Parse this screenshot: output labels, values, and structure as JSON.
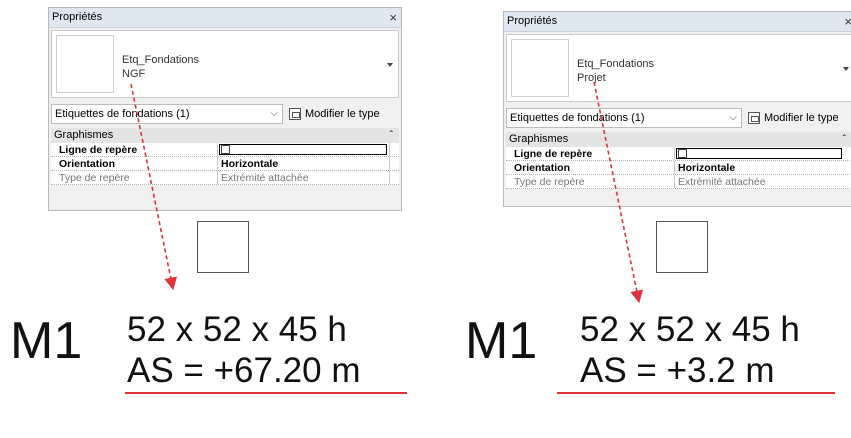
{
  "colors": {
    "arrow_red": "#e0323a",
    "title_bar": "#dfe7f1",
    "panel_bg": "#f0f0f0"
  },
  "left": {
    "title": "Propriétés",
    "close": "×",
    "type_name": "Etq_Fondations",
    "type_sub": "NGF",
    "filter_label": "Etiquettes de fondations (1)",
    "filter_chevron": "⌵",
    "edit_type": "Modifier le type",
    "section": "Graphismes",
    "section_chevron": "ˆ",
    "rows": [
      {
        "key": "Ligne de repère",
        "value": ""
      },
      {
        "key": "Orientation",
        "value": "Horizontale"
      },
      {
        "key": "Type de repère",
        "value": "Extrémité attachée"
      }
    ],
    "tag_mark": "M1",
    "tag_dims": "52 x 52 x 45 h",
    "tag_level": "AS = +67.20 m"
  },
  "right": {
    "title": "Propriétés",
    "close": "×",
    "type_name": "Etq_Fondations",
    "type_sub": "Projet",
    "filter_label": "Etiquettes de fondations (1)",
    "filter_chevron": "⌵",
    "edit_type": "Modifier le type",
    "section": "Graphismes",
    "section_chevron": "ˆ",
    "rows": [
      {
        "key": "Ligne de repère",
        "value": ""
      },
      {
        "key": "Orientation",
        "value": "Horizontale"
      },
      {
        "key": "Type de repère",
        "value": "Extrémité attachée"
      }
    ],
    "tag_mark": "M1",
    "tag_dims": "52 x 52 x 45 h",
    "tag_level": "AS = +3.2 m"
  }
}
